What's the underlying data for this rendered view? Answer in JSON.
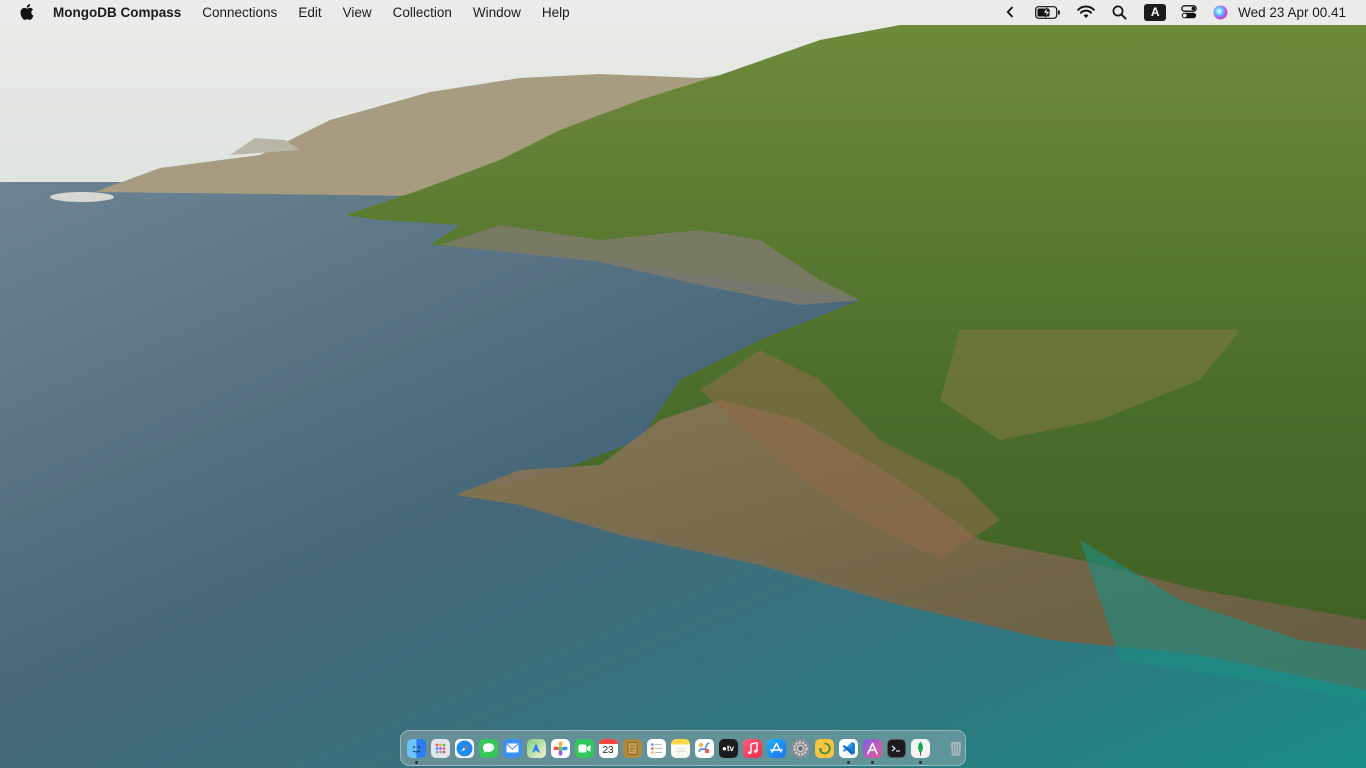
{
  "menubar": {
    "app_name": "MongoDB Compass",
    "menus": [
      "Connections",
      "Edit",
      "View",
      "Collection",
      "Window",
      "Help"
    ],
    "input_source": "A",
    "clock": "Wed 23 Apr  00.41"
  },
  "dock": {
    "calendar_day": "23",
    "apps": [
      {
        "name": "finder",
        "color": "#2f8ef2",
        "running": true
      },
      {
        "name": "launchpad",
        "color": "#d9d9e3",
        "running": false
      },
      {
        "name": "safari",
        "color": "#2d8cf0",
        "running": false
      },
      {
        "name": "messages",
        "color": "#34c759",
        "running": false
      },
      {
        "name": "mail",
        "color": "#3a8ff5",
        "running": false
      },
      {
        "name": "maps",
        "color": "#5ab55e",
        "running": false
      },
      {
        "name": "photos",
        "color": "#f3f3f3",
        "running": false
      },
      {
        "name": "facetime",
        "color": "#2fc75a",
        "running": false
      },
      {
        "name": "calendar",
        "color": "#ffffff",
        "running": false
      },
      {
        "name": "notes-app",
        "color": "#b08a3c",
        "running": false
      },
      {
        "name": "reminders",
        "color": "#ffffff",
        "running": false
      },
      {
        "name": "notes",
        "color": "#ffd84a",
        "running": false
      },
      {
        "name": "freeform",
        "color": "#ffffff",
        "running": false
      },
      {
        "name": "apple-tv",
        "color": "#1c1c1e",
        "running": false
      },
      {
        "name": "music",
        "color": "#fa3b54",
        "running": false
      },
      {
        "name": "app-store",
        "color": "#1c8cf6",
        "running": false
      },
      {
        "name": "system-settings",
        "color": "#8e8e93",
        "running": false
      },
      {
        "name": "android-file",
        "color": "#f6c343",
        "running": false
      },
      {
        "name": "vscode",
        "color": "#1f6fc1",
        "running": true
      },
      {
        "name": "instruments",
        "color": "#e84a8a",
        "running": true
      },
      {
        "name": "terminal",
        "color": "#1c1c1e",
        "running": false
      },
      {
        "name": "mongodb-compass",
        "color": "#f4f4f4",
        "running": true
      }
    ],
    "trash": {
      "name": "trash",
      "color": "#9aa3a8"
    }
  }
}
